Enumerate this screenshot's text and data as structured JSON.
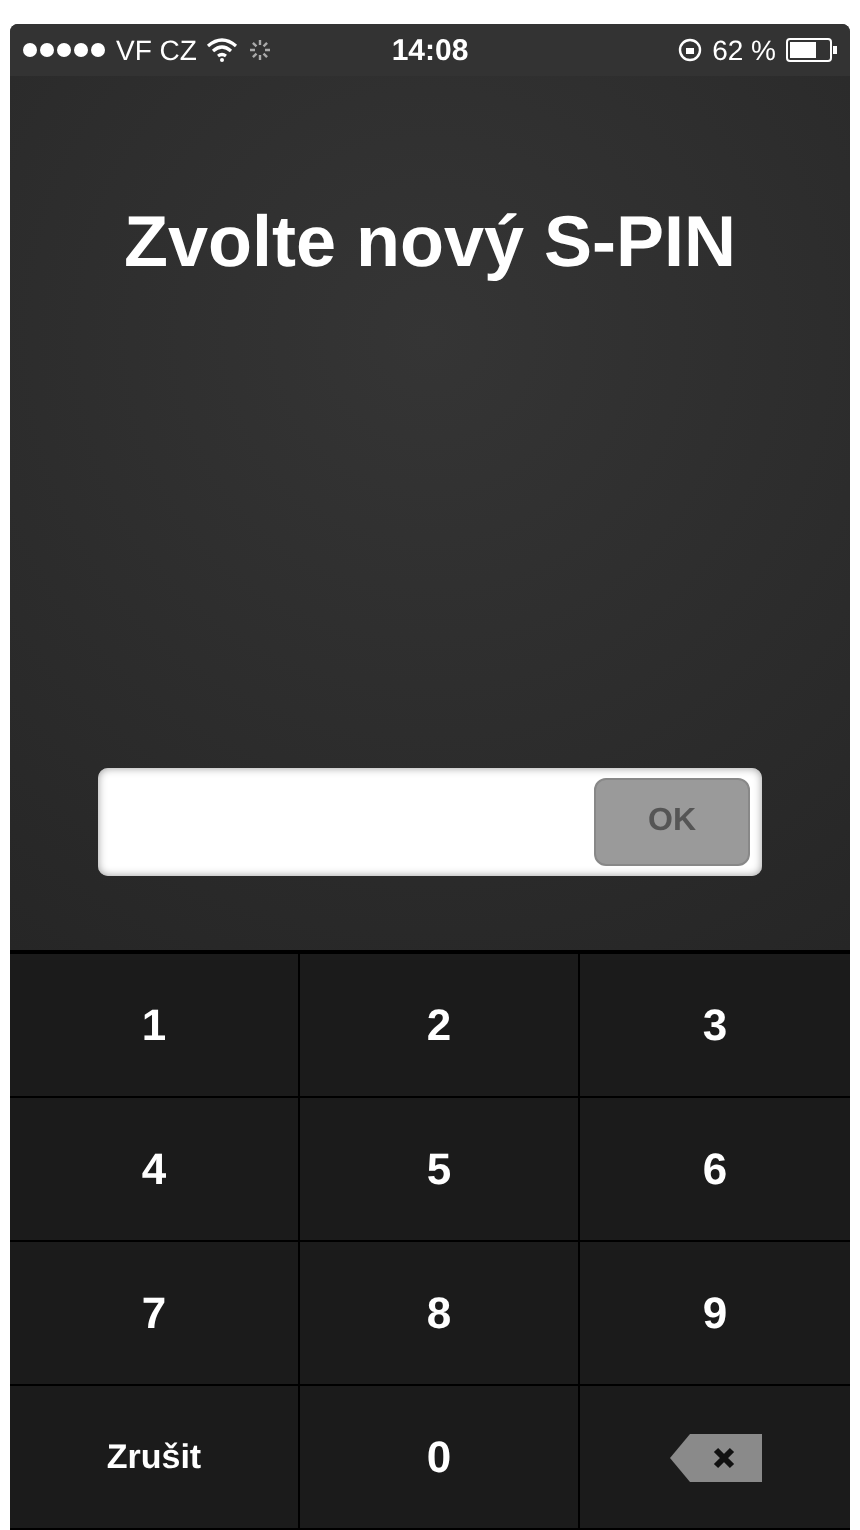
{
  "status_bar": {
    "carrier": "VF CZ",
    "time": "14:08",
    "battery": "62 %"
  },
  "title": "Zvolte nový S-PIN",
  "pin_field": {
    "button": "OK"
  },
  "keypad": [
    {
      "kind": "digit",
      "label": "1"
    },
    {
      "kind": "digit",
      "label": "2"
    },
    {
      "kind": "digit",
      "label": "3"
    },
    {
      "kind": "digit",
      "label": "4"
    },
    {
      "kind": "digit",
      "label": "5"
    },
    {
      "kind": "digit",
      "label": "6"
    },
    {
      "kind": "digit",
      "label": "7"
    },
    {
      "kind": "digit",
      "label": "8"
    },
    {
      "kind": "digit",
      "label": "9"
    },
    {
      "kind": "action",
      "label": "Zrušit"
    },
    {
      "kind": "digit",
      "label": "0"
    },
    {
      "kind": "backspace"
    }
  ]
}
